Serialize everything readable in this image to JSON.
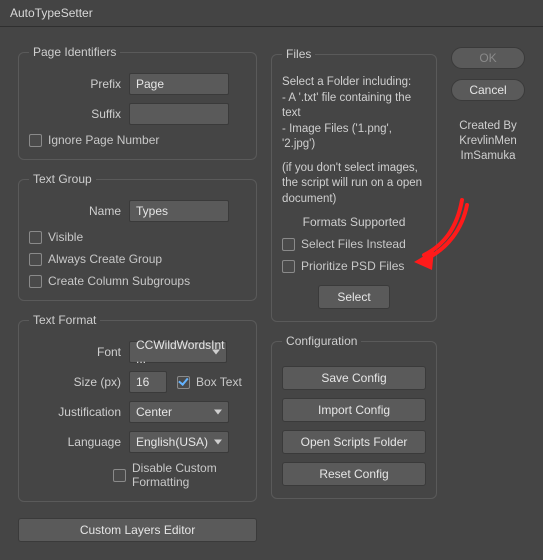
{
  "window": {
    "title": "AutoTypeSetter"
  },
  "pageIdentifiers": {
    "legend": "Page Identifiers",
    "prefixLabel": "Prefix",
    "prefixValue": "Page",
    "suffixLabel": "Suffix",
    "suffixValue": "",
    "ignoreLabel": "Ignore Page Number"
  },
  "textGroup": {
    "legend": "Text Group",
    "nameLabel": "Name",
    "nameValue": "Types",
    "visible": "Visible",
    "alwaysCreate": "Always Create Group",
    "columnSub": "Create Column Subgroups"
  },
  "textFormat": {
    "legend": "Text Format",
    "fontLabel": "Font",
    "fontValue": "CCWildWordsInt ...",
    "sizeLabel": "Size (px)",
    "sizeValue": "16",
    "boxText": "Box Text",
    "justificationLabel": "Justification",
    "justificationValue": "Center",
    "languageLabel": "Language",
    "languageValue": "English(USA)",
    "disableCustom": "Disable Custom Formatting"
  },
  "customLayers": "Custom Layers Editor",
  "files": {
    "legend": "Files",
    "hint1": "Select a Folder including:",
    "hint2": "- A '.txt' file containing the text",
    "hint3": "- Image Files ('1.png', '2.jpg')",
    "hint4": "(if you don't select images, the script will run on a open document)",
    "formats": "Formats Supported",
    "selectInstead": "Select Files Instead",
    "prioritize": "Prioritize PSD Files",
    "selectBtn": "Select"
  },
  "config": {
    "legend": "Configuration",
    "save": "Save Config",
    "import": "Import Config",
    "scripts": "Open Scripts Folder",
    "reset": "Reset Config"
  },
  "side": {
    "ok": "OK",
    "cancel": "Cancel",
    "createdBy": "Created By",
    "author1": "KrevlinMen",
    "author2": "ImSamuka"
  }
}
